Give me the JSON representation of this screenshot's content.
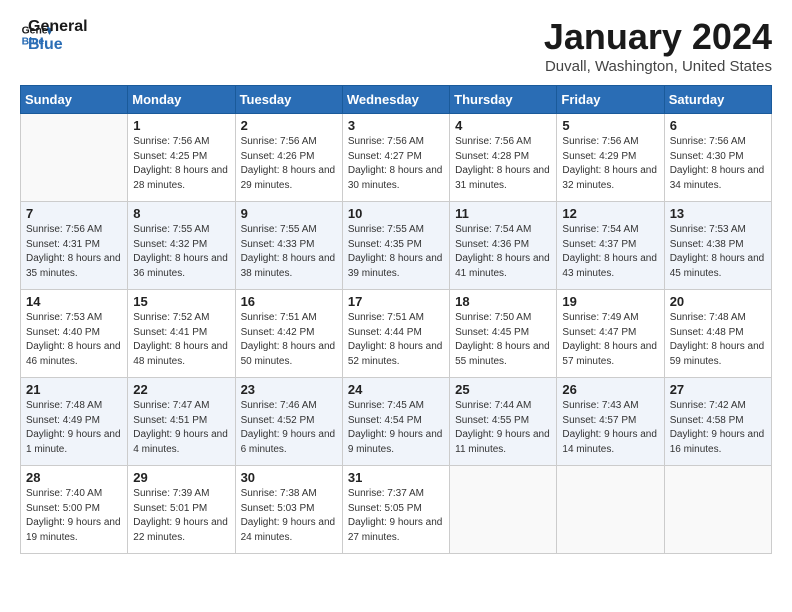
{
  "logo": {
    "line1": "General",
    "line2": "Blue"
  },
  "title": "January 2024",
  "location": "Duvall, Washington, United States",
  "weekdays": [
    "Sunday",
    "Monday",
    "Tuesday",
    "Wednesday",
    "Thursday",
    "Friday",
    "Saturday"
  ],
  "weeks": [
    [
      {
        "day": "",
        "sunrise": "",
        "sunset": "",
        "daylight": ""
      },
      {
        "day": "1",
        "sunrise": "Sunrise: 7:56 AM",
        "sunset": "Sunset: 4:25 PM",
        "daylight": "Daylight: 8 hours and 28 minutes."
      },
      {
        "day": "2",
        "sunrise": "Sunrise: 7:56 AM",
        "sunset": "Sunset: 4:26 PM",
        "daylight": "Daylight: 8 hours and 29 minutes."
      },
      {
        "day": "3",
        "sunrise": "Sunrise: 7:56 AM",
        "sunset": "Sunset: 4:27 PM",
        "daylight": "Daylight: 8 hours and 30 minutes."
      },
      {
        "day": "4",
        "sunrise": "Sunrise: 7:56 AM",
        "sunset": "Sunset: 4:28 PM",
        "daylight": "Daylight: 8 hours and 31 minutes."
      },
      {
        "day": "5",
        "sunrise": "Sunrise: 7:56 AM",
        "sunset": "Sunset: 4:29 PM",
        "daylight": "Daylight: 8 hours and 32 minutes."
      },
      {
        "day": "6",
        "sunrise": "Sunrise: 7:56 AM",
        "sunset": "Sunset: 4:30 PM",
        "daylight": "Daylight: 8 hours and 34 minutes."
      }
    ],
    [
      {
        "day": "7",
        "sunrise": "Sunrise: 7:56 AM",
        "sunset": "Sunset: 4:31 PM",
        "daylight": "Daylight: 8 hours and 35 minutes."
      },
      {
        "day": "8",
        "sunrise": "Sunrise: 7:55 AM",
        "sunset": "Sunset: 4:32 PM",
        "daylight": "Daylight: 8 hours and 36 minutes."
      },
      {
        "day": "9",
        "sunrise": "Sunrise: 7:55 AM",
        "sunset": "Sunset: 4:33 PM",
        "daylight": "Daylight: 8 hours and 38 minutes."
      },
      {
        "day": "10",
        "sunrise": "Sunrise: 7:55 AM",
        "sunset": "Sunset: 4:35 PM",
        "daylight": "Daylight: 8 hours and 39 minutes."
      },
      {
        "day": "11",
        "sunrise": "Sunrise: 7:54 AM",
        "sunset": "Sunset: 4:36 PM",
        "daylight": "Daylight: 8 hours and 41 minutes."
      },
      {
        "day": "12",
        "sunrise": "Sunrise: 7:54 AM",
        "sunset": "Sunset: 4:37 PM",
        "daylight": "Daylight: 8 hours and 43 minutes."
      },
      {
        "day": "13",
        "sunrise": "Sunrise: 7:53 AM",
        "sunset": "Sunset: 4:38 PM",
        "daylight": "Daylight: 8 hours and 45 minutes."
      }
    ],
    [
      {
        "day": "14",
        "sunrise": "Sunrise: 7:53 AM",
        "sunset": "Sunset: 4:40 PM",
        "daylight": "Daylight: 8 hours and 46 minutes."
      },
      {
        "day": "15",
        "sunrise": "Sunrise: 7:52 AM",
        "sunset": "Sunset: 4:41 PM",
        "daylight": "Daylight: 8 hours and 48 minutes."
      },
      {
        "day": "16",
        "sunrise": "Sunrise: 7:51 AM",
        "sunset": "Sunset: 4:42 PM",
        "daylight": "Daylight: 8 hours and 50 minutes."
      },
      {
        "day": "17",
        "sunrise": "Sunrise: 7:51 AM",
        "sunset": "Sunset: 4:44 PM",
        "daylight": "Daylight: 8 hours and 52 minutes."
      },
      {
        "day": "18",
        "sunrise": "Sunrise: 7:50 AM",
        "sunset": "Sunset: 4:45 PM",
        "daylight": "Daylight: 8 hours and 55 minutes."
      },
      {
        "day": "19",
        "sunrise": "Sunrise: 7:49 AM",
        "sunset": "Sunset: 4:47 PM",
        "daylight": "Daylight: 8 hours and 57 minutes."
      },
      {
        "day": "20",
        "sunrise": "Sunrise: 7:48 AM",
        "sunset": "Sunset: 4:48 PM",
        "daylight": "Daylight: 8 hours and 59 minutes."
      }
    ],
    [
      {
        "day": "21",
        "sunrise": "Sunrise: 7:48 AM",
        "sunset": "Sunset: 4:49 PM",
        "daylight": "Daylight: 9 hours and 1 minute."
      },
      {
        "day": "22",
        "sunrise": "Sunrise: 7:47 AM",
        "sunset": "Sunset: 4:51 PM",
        "daylight": "Daylight: 9 hours and 4 minutes."
      },
      {
        "day": "23",
        "sunrise": "Sunrise: 7:46 AM",
        "sunset": "Sunset: 4:52 PM",
        "daylight": "Daylight: 9 hours and 6 minutes."
      },
      {
        "day": "24",
        "sunrise": "Sunrise: 7:45 AM",
        "sunset": "Sunset: 4:54 PM",
        "daylight": "Daylight: 9 hours and 9 minutes."
      },
      {
        "day": "25",
        "sunrise": "Sunrise: 7:44 AM",
        "sunset": "Sunset: 4:55 PM",
        "daylight": "Daylight: 9 hours and 11 minutes."
      },
      {
        "day": "26",
        "sunrise": "Sunrise: 7:43 AM",
        "sunset": "Sunset: 4:57 PM",
        "daylight": "Daylight: 9 hours and 14 minutes."
      },
      {
        "day": "27",
        "sunrise": "Sunrise: 7:42 AM",
        "sunset": "Sunset: 4:58 PM",
        "daylight": "Daylight: 9 hours and 16 minutes."
      }
    ],
    [
      {
        "day": "28",
        "sunrise": "Sunrise: 7:40 AM",
        "sunset": "Sunset: 5:00 PM",
        "daylight": "Daylight: 9 hours and 19 minutes."
      },
      {
        "day": "29",
        "sunrise": "Sunrise: 7:39 AM",
        "sunset": "Sunset: 5:01 PM",
        "daylight": "Daylight: 9 hours and 22 minutes."
      },
      {
        "day": "30",
        "sunrise": "Sunrise: 7:38 AM",
        "sunset": "Sunset: 5:03 PM",
        "daylight": "Daylight: 9 hours and 24 minutes."
      },
      {
        "day": "31",
        "sunrise": "Sunrise: 7:37 AM",
        "sunset": "Sunset: 5:05 PM",
        "daylight": "Daylight: 9 hours and 27 minutes."
      },
      {
        "day": "",
        "sunrise": "",
        "sunset": "",
        "daylight": ""
      },
      {
        "day": "",
        "sunrise": "",
        "sunset": "",
        "daylight": ""
      },
      {
        "day": "",
        "sunrise": "",
        "sunset": "",
        "daylight": ""
      }
    ]
  ]
}
